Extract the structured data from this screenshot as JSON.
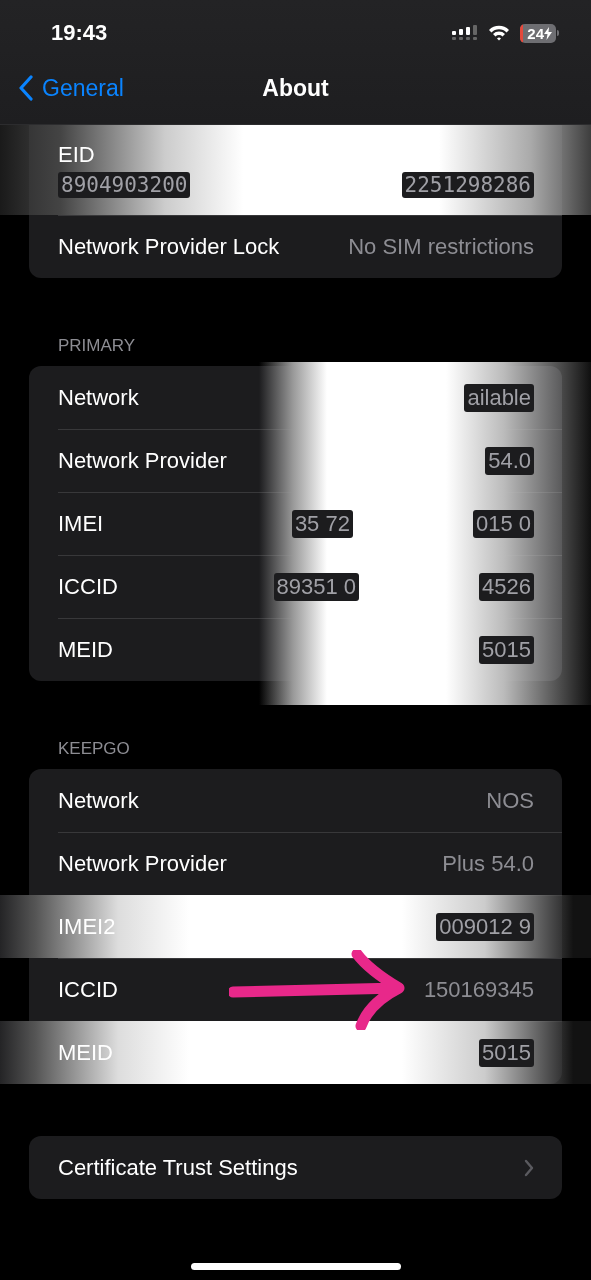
{
  "status_bar": {
    "time": "19:43",
    "battery": "24"
  },
  "nav": {
    "back": "General",
    "title": "About"
  },
  "sections": [
    {
      "rows": [
        {
          "kind": "stacked",
          "label": "EID",
          "redacted": true,
          "value_parts": [
            "8904903200",
            "2251298286"
          ]
        },
        {
          "kind": "value",
          "label": "Network Provider Lock",
          "value_parts": [
            "No SIM restrictions"
          ]
        }
      ]
    },
    {
      "header": "PRIMARY",
      "redacted_column": true,
      "rows": [
        {
          "kind": "value",
          "label": "Network",
          "value_parts": [
            "ailable"
          ]
        },
        {
          "kind": "value",
          "label": "Network Provider",
          "value_parts": [
            "54.0"
          ]
        },
        {
          "kind": "value",
          "label": "IMEI",
          "value_parts": [
            "35 72",
            "015 0"
          ]
        },
        {
          "kind": "value",
          "label": "ICCID",
          "value_parts": [
            "89351 0",
            "4526"
          ]
        },
        {
          "kind": "value",
          "label": "MEID",
          "value_parts": [
            "5015"
          ]
        }
      ]
    },
    {
      "header": "KEEPGO",
      "rows": [
        {
          "kind": "value",
          "label": "Network",
          "value_parts": [
            "NOS"
          ]
        },
        {
          "kind": "value",
          "label": "Network Provider",
          "value_parts": [
            "Plus 54.0"
          ]
        },
        {
          "kind": "value",
          "label": "IMEI2",
          "redacted": true,
          "value_parts": [
            "009012 9"
          ]
        },
        {
          "kind": "value",
          "label": "ICCID",
          "arrow": true,
          "value_parts": [
            "150169345"
          ]
        },
        {
          "kind": "value",
          "label": "MEID",
          "redacted": true,
          "value_parts": [
            "5015"
          ]
        }
      ]
    },
    {
      "rows": [
        {
          "kind": "link",
          "label": "Certificate Trust Settings"
        }
      ]
    }
  ]
}
